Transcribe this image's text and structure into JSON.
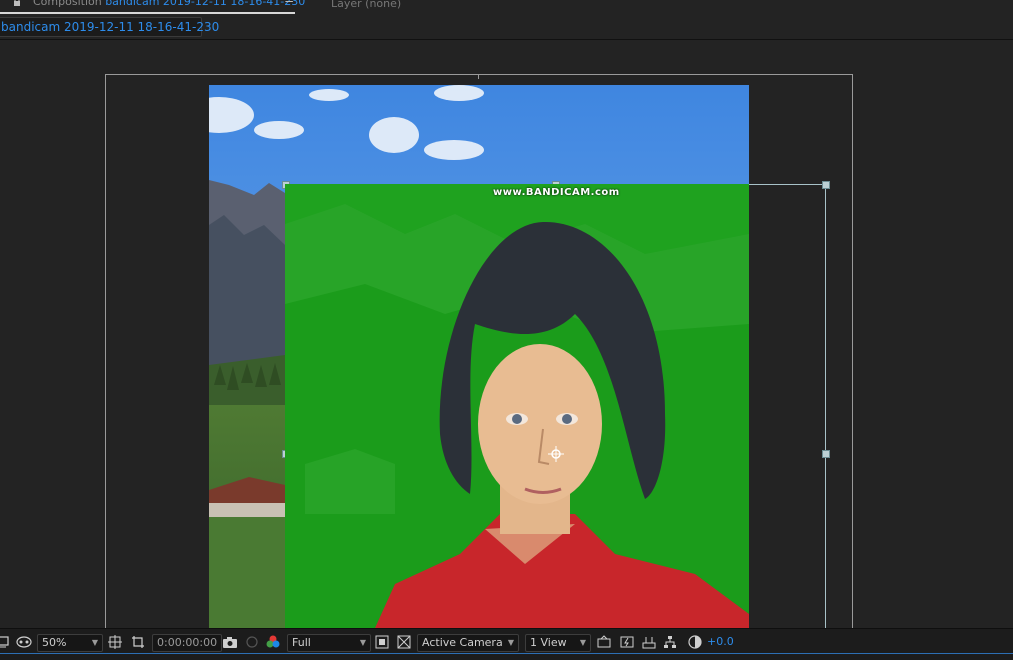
{
  "header": {
    "composition_prefix": "Composition",
    "composition_name": "bandicam 2019-12-11 18-16-41-230",
    "menu_glyph": "≡",
    "layer_label": "Layer (none)"
  },
  "tab": {
    "label": "bandicam 2019-12-11 18-16-41-230"
  },
  "viewer": {
    "watermark": "www.BANDICAM.com"
  },
  "toolbar": {
    "zoom": "50%",
    "timecode": "0:00:00:00",
    "resolution": "Full",
    "camera": "Active Camera",
    "views": "1 View",
    "exposure": "+0.0"
  },
  "colors": {
    "accent_blue": "#2d8ceb",
    "green_screen": "#1fa21f",
    "sky": "#4a90e2"
  },
  "icons": [
    "lock-icon",
    "menu-icon",
    "monitor-icon",
    "mask-icon",
    "grid-icon",
    "crop-icon",
    "camera-icon",
    "color-channel-icon",
    "checkerboard-icon",
    "transparency-grid-icon",
    "fast-preview-icon",
    "flowchart-icon",
    "exposure-icon"
  ]
}
